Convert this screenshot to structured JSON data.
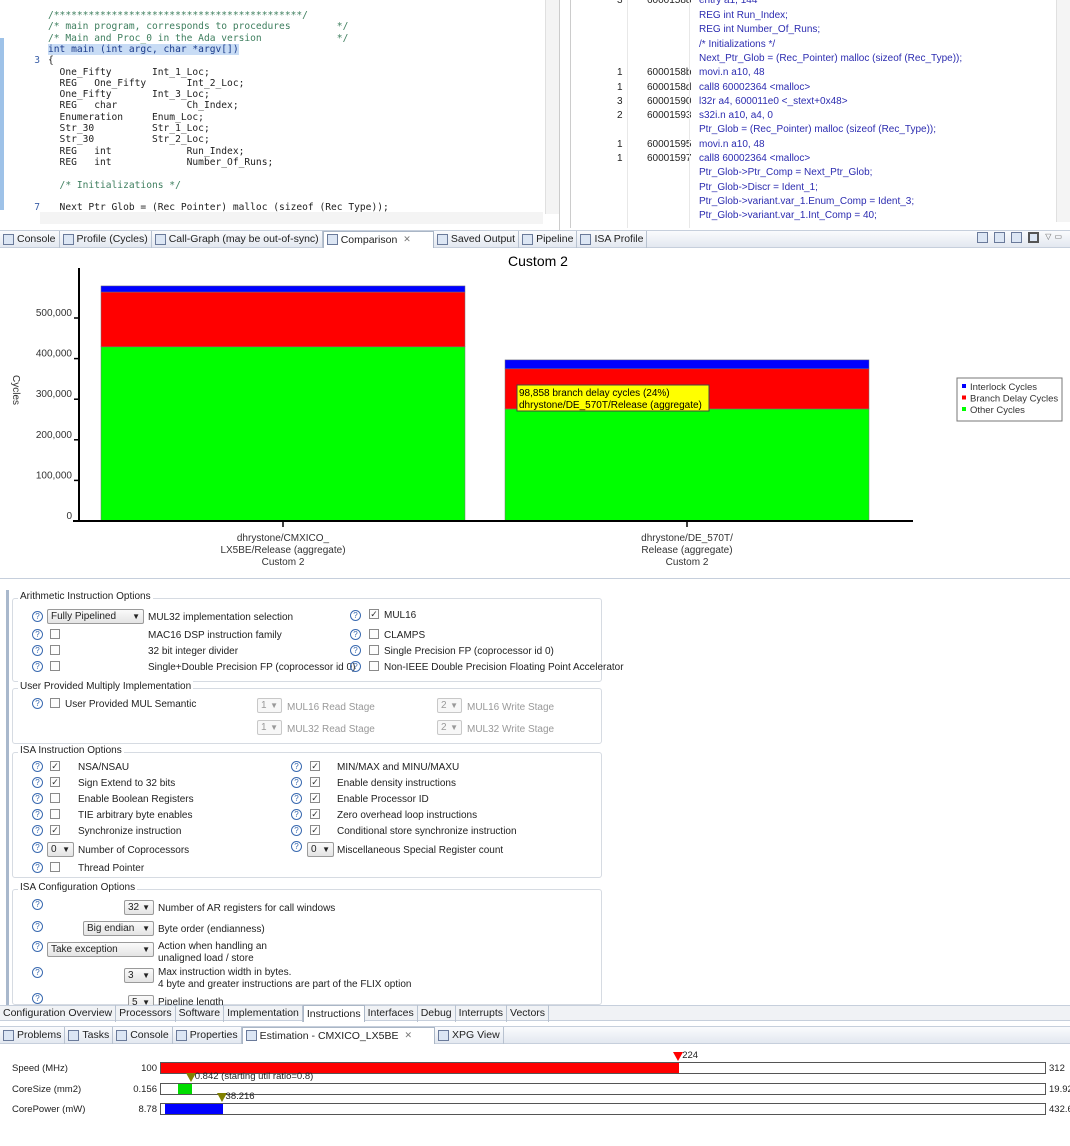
{
  "code_editor": {
    "lines": [
      {
        "num": "",
        "text": "/*******************************************/",
        "cls": "cm"
      },
      {
        "num": "",
        "text": "/* main program, corresponds to procedures        */",
        "cls": "cm"
      },
      {
        "num": "",
        "text": "/* Main and Proc_0 in the Ada version             */",
        "cls": "cm"
      },
      {
        "num": "",
        "text": "int main (int argc, char *argv[])",
        "cls": "sel"
      },
      {
        "num": "3",
        "text": "{",
        "cls": ""
      },
      {
        "num": "",
        "text": "  One_Fifty       Int_1_Loc;",
        "cls": ""
      },
      {
        "num": "",
        "text": "  REG   One_Fifty       Int_2_Loc;",
        "cls": ""
      },
      {
        "num": "",
        "text": "  One_Fifty       Int_3_Loc;",
        "cls": ""
      },
      {
        "num": "",
        "text": "  REG   char            Ch_Index;",
        "cls": ""
      },
      {
        "num": "",
        "text": "  Enumeration     Enum_Loc;",
        "cls": ""
      },
      {
        "num": "",
        "text": "  Str_30          Str_1_Loc;",
        "cls": ""
      },
      {
        "num": "",
        "text": "  Str_30          Str_2_Loc;",
        "cls": ""
      },
      {
        "num": "",
        "text": "  REG   int             Run_Index;",
        "cls": ""
      },
      {
        "num": "",
        "text": "  REG   int             Number_Of_Runs;",
        "cls": ""
      },
      {
        "num": "",
        "text": "",
        "cls": ""
      },
      {
        "num": "",
        "text": "  /* Initializations */",
        "cls": "cm"
      },
      {
        "num": "",
        "text": "",
        "cls": ""
      },
      {
        "num": "7",
        "text": "  Next_Ptr_Glob = (Rec_Pointer) malloc (sizeof (Rec_Type));",
        "cls": ""
      }
    ]
  },
  "disassembly": {
    "rows": [
      {
        "count": "",
        "addr": "",
        "text": "REG  int          Run_Index;"
      },
      {
        "count": "",
        "addr": "",
        "text": "REG  int          Number_Of_Runs;"
      },
      {
        "count": "",
        "addr": "",
        "text": "/* Initializations */"
      },
      {
        "count": "",
        "addr": "",
        "text": "Next_Ptr_Glob = (Rec_Pointer) malloc (sizeof (Rec_Type));"
      },
      {
        "count": "1",
        "addr": "6000158b",
        "text": " movi.n a10, 48"
      },
      {
        "count": "1",
        "addr": "6000158d",
        "text": " call8 60002364 <malloc>"
      },
      {
        "count": "3",
        "addr": "60001590",
        "text": " l32r a4, 600011e0 <_stext+0x48>"
      },
      {
        "count": "2",
        "addr": "60001593",
        "text": " s32i.n a10, a4, 0"
      },
      {
        "count": "",
        "addr": "",
        "text": "Ptr_Glob = (Rec_Pointer) malloc (sizeof (Rec_Type));"
      },
      {
        "count": "1",
        "addr": "60001595",
        "text": " movi.n a10, 48"
      },
      {
        "count": "1",
        "addr": "60001597",
        "text": " call8 60002364 <malloc>"
      },
      {
        "count": "",
        "addr": "",
        "text": "Ptr_Glob->Ptr_Comp              = Next_Ptr_Glob;"
      },
      {
        "count": "",
        "addr": "",
        "text": "Ptr_Glob->Discr                 = Ident_1;"
      },
      {
        "count": "",
        "addr": "",
        "text": "Ptr_Glob->variant.var_1.Enum_Comp    = Ident_3;"
      },
      {
        "count": "",
        "addr": "",
        "text": "Ptr_Glob->variant.var_1.Int_Comp     = 40;"
      }
    ]
  },
  "view_tabs": [
    {
      "label": "Console",
      "active": false
    },
    {
      "label": "Profile (Cycles)",
      "active": false
    },
    {
      "label": "Call-Graph (may be out-of-sync)",
      "active": false
    },
    {
      "label": "Comparison",
      "active": true
    },
    {
      "label": "Saved Output",
      "active": false
    },
    {
      "label": "Pipeline",
      "active": false
    },
    {
      "label": "ISA Profile",
      "active": false
    }
  ],
  "chart_data": {
    "type": "bar",
    "stacked": true,
    "title": "Custom 2",
    "ylabel": "Cycles",
    "xlabel": "",
    "ylim": [
      0,
      590000
    ],
    "yticks": [
      "0",
      "100,000",
      "200,000",
      "300,000",
      "400,000",
      "500,000"
    ],
    "categories": [
      [
        "dhrystone/CMXICO_",
        "LX5BE/Release (aggregate)",
        "Custom 2"
      ],
      [
        "dhrystone/DE_570T/",
        "Release (aggregate)",
        "Custom 2"
      ]
    ],
    "series": [
      {
        "name": "Other Cycles",
        "color": "#00ff00",
        "values": [
          429000,
          276000
        ]
      },
      {
        "name": "Branch Delay Cycles",
        "color": "#ff0000",
        "values": [
          135000,
          98858
        ]
      },
      {
        "name": "Interlock Cycles",
        "color": "#0000ff",
        "values": [
          15000,
          22000
        ]
      }
    ],
    "legend_order": [
      "Interlock Cycles",
      "Branch Delay Cycles",
      "Other Cycles"
    ],
    "legend": "right",
    "grid": false,
    "tooltip": [
      "98,858 branch delay cycles (24%)",
      "dhrystone/DE_570T/Release (aggregate)"
    ]
  },
  "options": {
    "arith": {
      "title": "Arithmetic Instruction Options",
      "mul32_value": "Fully Pipelined",
      "mul32_label": "MUL32 implementation selection",
      "mac16": "MAC16 DSP instruction family",
      "div32": "32 bit integer divider",
      "dfp": "Single+Double Precision FP (coprocessor id 0)",
      "mul16": "MUL16",
      "clamps": "CLAMPS",
      "sfp": "Single Precision FP (coprocessor id 0)",
      "nonieee": "Non-IEEE Double Precision Floating Point Accelerator"
    },
    "usermul": {
      "title": "User Provided Multiply Implementation",
      "sem": "User Provided MUL Semantic",
      "m16r": "MUL16 Read Stage",
      "m16r_v": "1",
      "m32r": "MUL32 Read Stage",
      "m32r_v": "1",
      "m16w": "MUL16 Write Stage",
      "m16w_v": "2",
      "m32w": "MUL32 Write Stage",
      "m32w_v": "2"
    },
    "isa": {
      "title": "ISA Instruction Options",
      "left": [
        {
          "label": "NSA/NSAU",
          "checked": true
        },
        {
          "label": "Sign Extend to 32 bits",
          "checked": true
        },
        {
          "label": "Enable Boolean Registers",
          "checked": false
        },
        {
          "label": "TIE arbitrary byte enables",
          "checked": false
        },
        {
          "label": "Synchronize instruction",
          "checked": true
        }
      ],
      "right": [
        {
          "label": "MIN/MAX and MINU/MAXU",
          "checked": true
        },
        {
          "label": "Enable density instructions",
          "checked": true
        },
        {
          "label": "Enable Processor ID",
          "checked": true
        },
        {
          "label": "Zero overhead loop instructions",
          "checked": true
        },
        {
          "label": "Conditional store synchronize instruction",
          "checked": true
        }
      ],
      "coproc_v": "0",
      "coproc": "Number of Coprocessors",
      "misc_v": "0",
      "misc": "Miscellaneous Special Register count",
      "thread": "Thread Pointer"
    },
    "config": {
      "title": "ISA Configuration Options",
      "ar_v": "32",
      "ar": "Number of AR registers for call windows",
      "endian_v": "Big endian",
      "endian": "Byte order (endianness)",
      "unal_v": "Take exception",
      "unal1": "Action when handling an",
      "unal2": "unaligned load / store",
      "width_v": "3",
      "width1": "Max instruction width in bytes.",
      "width2": "4 byte and greater instructions are part of the FLIX option",
      "pipe_v": "5",
      "pipe": "Pipeline length"
    }
  },
  "config_tabs": [
    "Configuration Overview",
    "Processors",
    "Software",
    "Implementation",
    "Instructions",
    "Interfaces",
    "Debug",
    "Interrupts",
    "Vectors"
  ],
  "config_tab_active": "Instructions",
  "bottom_tabs": [
    {
      "label": "Problems"
    },
    {
      "label": "Tasks"
    },
    {
      "label": "Console"
    },
    {
      "label": "Properties"
    },
    {
      "label": "Estimation - CMXICO_LX5BE",
      "active": true
    },
    {
      "label": "XPG View"
    }
  ],
  "estimation": [
    {
      "label": "Speed (MHz)",
      "min": "100",
      "max": "312",
      "value": "224",
      "min_n": 100,
      "max_n": 312,
      "value_n": 224,
      "color": "#ff0000",
      "marker_color": "#ff0000"
    },
    {
      "label": "CoreSize (mm2)",
      "min": "0.156",
      "max": "19.92",
      "value": "0.842 (starting util ratio=0.8)",
      "min_n": 0.156,
      "max_n": 19.92,
      "value_n": 0.842,
      "color": "#00dd00",
      "marker_color": "#808000"
    },
    {
      "label": "CorePower (mW)",
      "min": "8.78",
      "max": "432.6",
      "value": "38.216",
      "min_n": 8.78,
      "max_n": 432.6,
      "value_n": 38.216,
      "color": "#0000ff",
      "marker_color": "#808000"
    }
  ]
}
